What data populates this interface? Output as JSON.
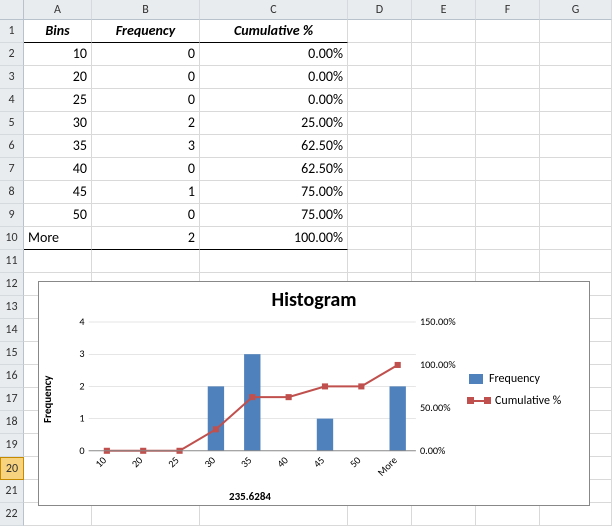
{
  "columns": [
    "A",
    "B",
    "C",
    "D",
    "E",
    "F",
    "G"
  ],
  "headers": {
    "bins": "Bins",
    "freq": "Frequency",
    "cum": "Cumulative %"
  },
  "rows": [
    {
      "bin": "10",
      "freq": "0",
      "cum": "0.00%"
    },
    {
      "bin": "20",
      "freq": "0",
      "cum": "0.00%"
    },
    {
      "bin": "25",
      "freq": "0",
      "cum": "0.00%"
    },
    {
      "bin": "30",
      "freq": "2",
      "cum": "25.00%"
    },
    {
      "bin": "35",
      "freq": "3",
      "cum": "62.50%"
    },
    {
      "bin": "40",
      "freq": "0",
      "cum": "62.50%"
    },
    {
      "bin": "45",
      "freq": "1",
      "cum": "75.00%"
    },
    {
      "bin": "50",
      "freq": "0",
      "cum": "75.00%"
    },
    {
      "bin": "More",
      "freq": "2",
      "cum": "100.00%"
    }
  ],
  "selected_row": 20,
  "chart_data": {
    "type": "bar",
    "title": "Histogram",
    "ylabel": "Frequency",
    "categories": [
      "10",
      "20",
      "25",
      "30",
      "35",
      "40",
      "45",
      "50",
      "More"
    ],
    "series": [
      {
        "name": "Frequency",
        "kind": "bar",
        "values": [
          0,
          0,
          0,
          2,
          3,
          0,
          1,
          0,
          2
        ],
        "color": "#4f81bd"
      },
      {
        "name": "Cumulative %",
        "kind": "line",
        "values": [
          0,
          0,
          0,
          25,
          62.5,
          62.5,
          75,
          75,
          100
        ],
        "color": "#c0504d"
      }
    ],
    "ylim": [
      0,
      4
    ],
    "y2_ticks": [
      "0.00%",
      "50.00%",
      "100.00%",
      "150.00%"
    ],
    "y2_max": 150,
    "x_extra_label": "235.6284",
    "legend": {
      "freq": "Frequency",
      "cum": "Cumulative %"
    }
  }
}
